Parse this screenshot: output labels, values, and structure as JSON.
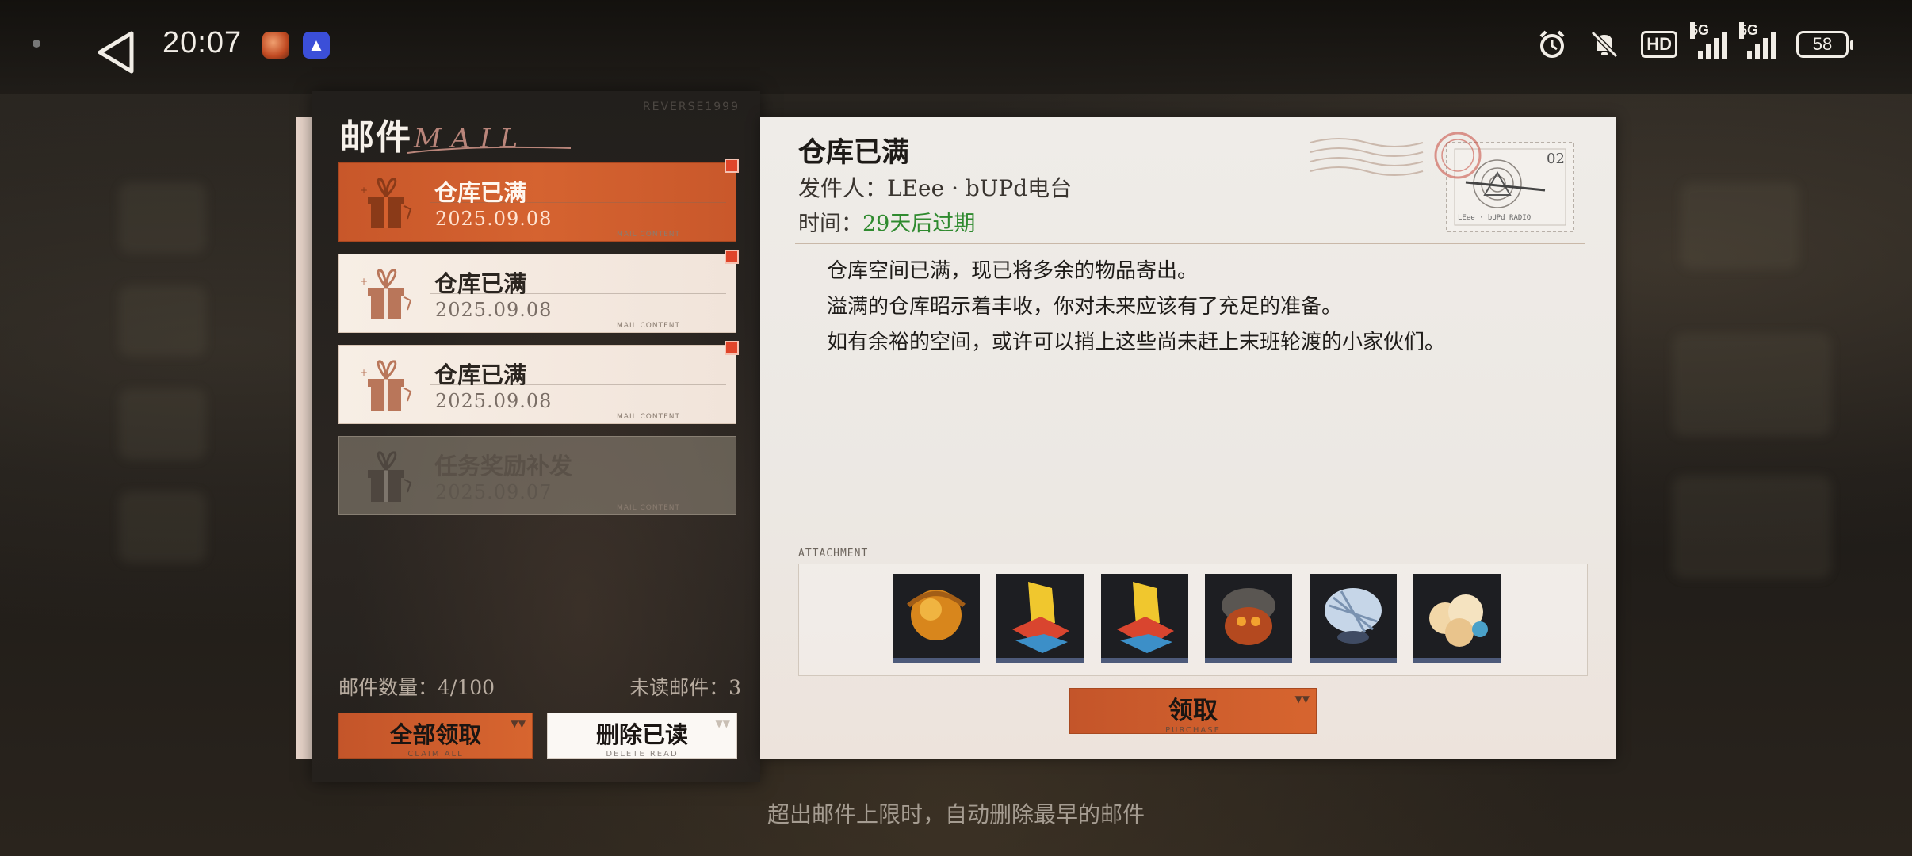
{
  "status_bar": {
    "time": "20:07",
    "battery": "58",
    "hd_label": "HD",
    "network_1": "5G",
    "network_2": "5G"
  },
  "mail_panel": {
    "title": "邮件",
    "title_en": "MAIL",
    "brand": "REVERSE1999",
    "items": [
      {
        "title": "仓库已满",
        "date": "2025.09.08",
        "state": "selected",
        "unread": true,
        "tag": "MAIL CONTENT"
      },
      {
        "title": "仓库已满",
        "date": "2025.09.08",
        "state": "unread",
        "unread": true,
        "tag": "MAIL CONTENT"
      },
      {
        "title": "仓库已满",
        "date": "2025.09.08",
        "state": "unread",
        "unread": true,
        "tag": "MAIL CONTENT"
      },
      {
        "title": "任务奖励补发",
        "date": "2025.09.07",
        "state": "read",
        "unread": false,
        "tag": "MAIL CONTENT"
      }
    ],
    "count_label": "邮件数量：4/100",
    "unread_label": "未读邮件：3",
    "claim_all": {
      "label": "全部领取",
      "sub": "CLAIM ALL"
    },
    "delete_read": {
      "label": "删除已读",
      "sub": "DELETE READ"
    }
  },
  "mail_detail": {
    "subject": "仓库已满",
    "sender": "发件人：LEee · bUPd电台",
    "time_label": "时间：",
    "time_value": "29天后过期",
    "body": [
      "仓库空间已满，现已将多余的物品寄出。",
      "溢满的仓库昭示着丰收，你对未来应该有了充足的准备。",
      "如有余裕的空间，或许可以捎上这些尚未赶上末班轮渡的小家伙们。"
    ],
    "stamp_number": "02",
    "stamp_caption": "LEee · bUPd RADIO",
    "attachment_label": "ATTACHMENT",
    "attachments": [
      {
        "name": "orange-orb-item"
      },
      {
        "name": "yellow-creature-item"
      },
      {
        "name": "yellow-creature-item"
      },
      {
        "name": "dark-beetle-item"
      },
      {
        "name": "blue-feather-item"
      },
      {
        "name": "cream-puff-item"
      }
    ],
    "claim": {
      "label": "领取",
      "sub": "PURCHASE"
    }
  },
  "footer_note": "超出邮件上限时，自动删除最早的邮件",
  "colors": {
    "accent_orange": "#d3602e",
    "expiry_green": "#2f8a2f",
    "unread_flag": "#e0452a"
  }
}
